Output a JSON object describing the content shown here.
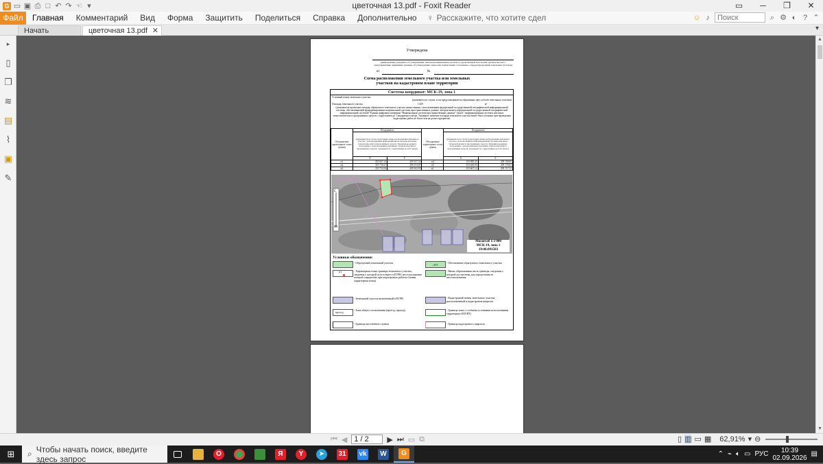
{
  "window": {
    "title": "цветочная 13.pdf - Foxit Reader"
  },
  "ribbon": {
    "file": "Файл",
    "tabs": [
      "Главная",
      "Комментарий",
      "Вид",
      "Форма",
      "Защитить",
      "Поделиться",
      "Справка",
      "Дополнительно"
    ],
    "tell_me": "Расскажите, что хотите сдел",
    "search_placeholder": "Поиск"
  },
  "doc_tabs": {
    "start": "Начать",
    "current": "цветочная 13.pdf"
  },
  "pdf": {
    "approve": "Утверждена",
    "approve_note": "(наименование документа об утверждении, включая наименования органов государственной власти или органов местного самоуправления, принявших решение об утверждении схемы или подписавших соглашение о перераспределении земельных участков)",
    "from_label": "от",
    "number_label": "№",
    "heading_line1": "Схема расположения земельного участка или земельных",
    "heading_line2": "участков на кадастровом плане территории",
    "coord_system": "Система координат: МСК-19, зона 1",
    "conditional_number": "Условный номер земельного участка",
    "conditional_note": "(указывается в случае, если предусматривается образование двух и более земельных участков)",
    "area_label": "Площадь земельного участка",
    "area_value": "1 429",
    "area_unit": "м²",
    "area_note": "(указывается проектная площадь образуемого земельного участка, вычисленная с использованием федеральной государственной географической информационной системы, обеспечивающей функционирование национальной системы пространственных данных, которая является федеральной государственной географической информационной системой \"Единая цифровая платформа \"Национальная система пространственных данных\" (далее - информационная система) или иных технологических и программных средств с округлением до 1 квадратного метра. Указанное значение площади земельного участка может быть уточнено при проведении кадастровых работ не более чем на десять процентов)",
    "table": {
      "col_designation": "Обозначение характерных точек границ",
      "col_coords": "Координаты",
      "coords_note": "(указываются в случае подготовки схемы расположения земельного участка с использованием информационной системы или иных технологических и программных средств. Значения координат, полученные с использованием указанных технологических и программных средств, указываются с округлением до 0,01 метра)",
      "x": "X",
      "y": "Y",
      "rows_left": [
        {
          "n": "н1",
          "x": "353 667,14",
          "y": "209 157,33"
        },
        {
          "n": "н2",
          "x": "353 730,27",
          "y": "209 153,87"
        },
        {
          "n": "н3",
          "x": "353 733,33",
          "y": "209 165,95"
        }
      ],
      "rows_right": [
        {
          "n": "н4",
          "x": "353 690,45",
          "y": "209 190,69"
        },
        {
          "n": "н5",
          "x": "353 649,03",
          "y": "209 176,63"
        },
        {
          "n": "н1",
          "x": "353 667,14",
          "y": "209 157,33"
        }
      ]
    },
    "map": {
      "north_label": "С",
      "south_label": "Ю",
      "scale": "Масштаб 1:3 000",
      "scale_zone": "МСК-19, зона 1",
      "cadastral_quarter": "19:06:091503"
    },
    "legend_title": "Условные обозначения:",
    "legend": [
      "- Образуемый земельный участок",
      "- Обозначение образуемого земельного участка",
      "- Характерная точка границы земельного участка, сведения о которой отсутствуют в ЕГРН, местоположение которой определено при кадастровых работах (новая характерная точка)",
      "- Вновь образованная часть границы, сведения о которой достаточны для определения ее местоположения",
      "- Земельный участок включенный в ЕГРН",
      "- Кадастровый номер земельного участка, расположенный в кадастровом квартале",
      "- Зона общего пользования (проезд, проход)",
      "- Граница зоны с особыми условиями использования территории (ЗОУИТ)",
      "- Граница населённого пункта",
      "- Граница кадастрового квартала"
    ],
    "legend_sw_label": ":ЗУ1",
    "legend_dot_label": "н1",
    "legend_zone_label": "проезд"
  },
  "nav": {
    "page": "1 / 2",
    "zoom": "62,91%"
  },
  "taskbar": {
    "search_placeholder": "Чтобы начать поиск, введите здесь запрос",
    "lang": "РУС",
    "time": "10:39",
    "date": "02.09.2026",
    "calendar_num": "31"
  },
  "colors": {
    "accent": "#f08c1e",
    "parcel": "#b3e6b3",
    "egrn": "#c8c8e6"
  }
}
